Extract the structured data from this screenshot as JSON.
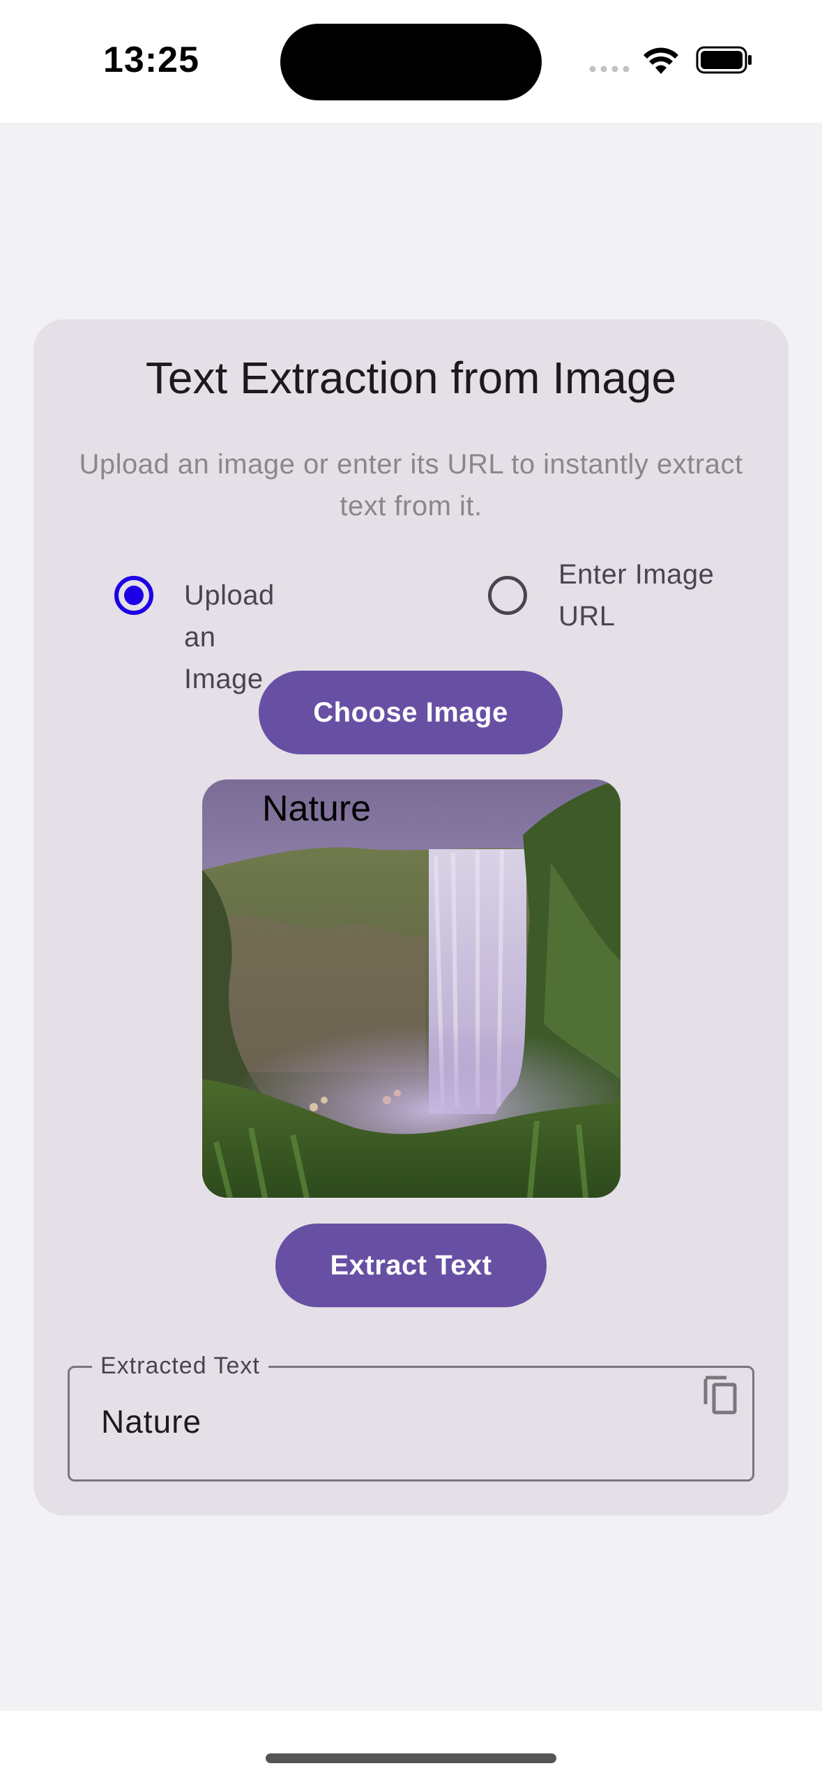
{
  "status_bar": {
    "time": "13:25"
  },
  "card": {
    "title": "Text Extraction from Image",
    "subtitle": "Upload an image or enter its URL to instantly extract text from it.",
    "radio_options": [
      {
        "label": "Upload an Image",
        "selected": true
      },
      {
        "label": "Enter Image URL",
        "selected": false
      }
    ],
    "choose_button_label": "Choose Image",
    "preview_caption": "Nature",
    "extract_button_label": "Extract Text",
    "extracted_field": {
      "label": "Extracted Text",
      "value": "Nature"
    }
  },
  "colors": {
    "accent": "#6750a4",
    "radio_selected": "#1c00e6",
    "card_background": "#e5e0e7",
    "page_background": "#f2f2f5"
  },
  "icons": [
    "wifi-icon",
    "battery-icon",
    "signal-dots-icon",
    "copy-icon"
  ]
}
